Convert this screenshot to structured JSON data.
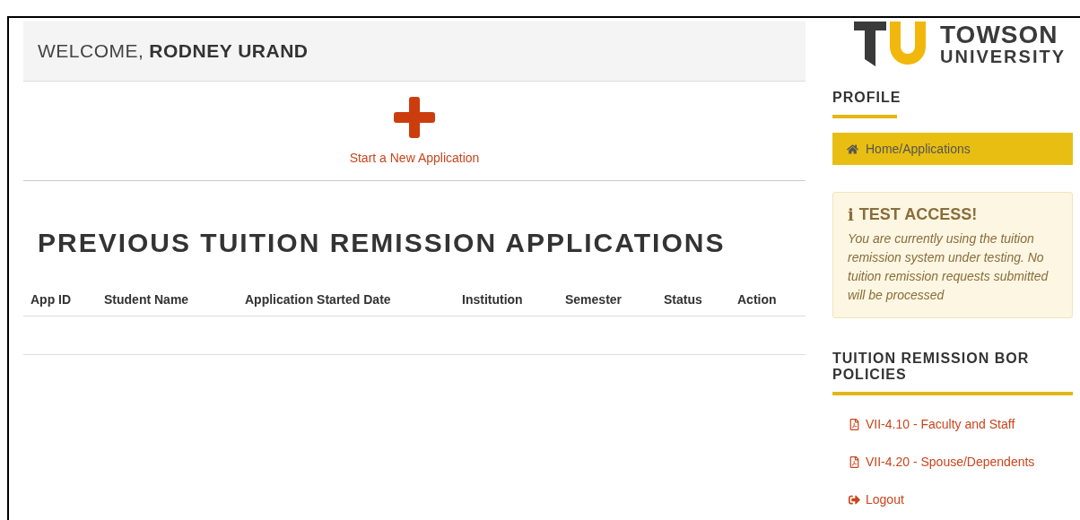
{
  "welcome": {
    "greeting": "WELCOME,",
    "name": "RODNEY URAND"
  },
  "new_application": {
    "label": "Start a New Application"
  },
  "previous": {
    "title": "PREVIOUS TUITION REMISSION APPLICATIONS",
    "columns": [
      "App ID",
      "Student Name",
      "Application Started Date",
      "Institution",
      "Semester",
      "Status",
      "Action"
    ]
  },
  "sidebar": {
    "logo": {
      "line_1": "TOWSON",
      "line_2": "UNIVERSITY"
    },
    "profile": {
      "heading": "PROFILE",
      "link": "Home/Applications"
    },
    "alert": {
      "icon": "i",
      "title": "TEST ACCESS!",
      "message": "You are currently using the tuition remission system under testing. No tuition remission requests submitted will be processed"
    },
    "policies": {
      "heading": "TUITION REMISSION BOR POLICIES",
      "links": [
        {
          "label": "VII-4.10 - Faculty and Staff"
        },
        {
          "label": "VII-4.20 - Spouse/Dependents"
        }
      ]
    },
    "logout": "Logout"
  }
}
